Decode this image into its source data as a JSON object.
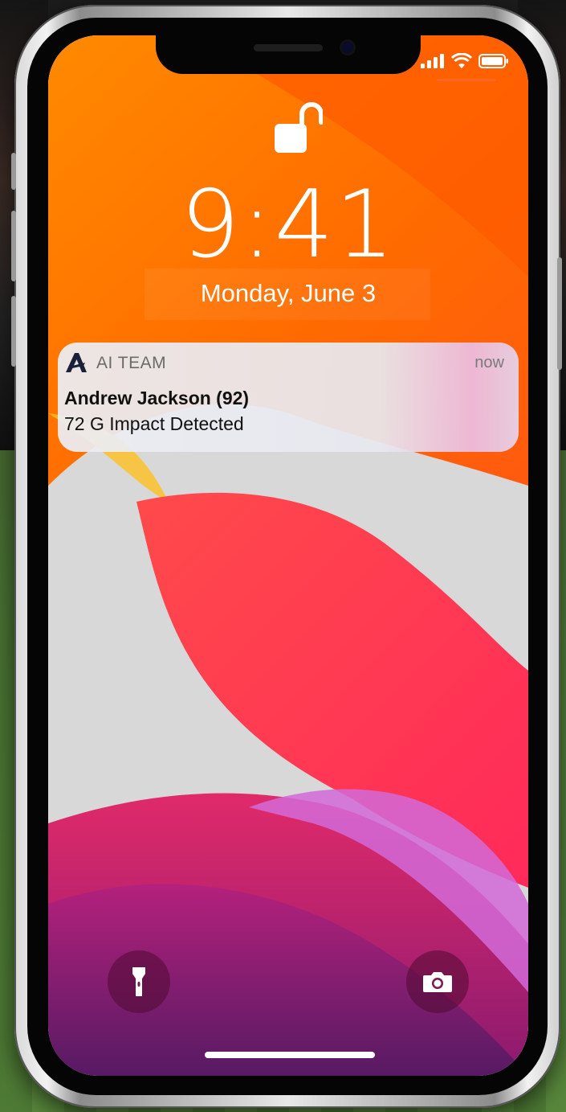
{
  "lockscreen": {
    "time": "9:41",
    "date": "Monday, June 3"
  },
  "notification": {
    "app_name": "AI TEAM",
    "timestamp": "now",
    "title": "Andrew Jackson (92)",
    "body": "72 G Impact Detected",
    "icon": "ai-team-logo-icon"
  },
  "status_bar": {
    "icons": [
      "cellular-signal-icon",
      "wifi-icon",
      "battery-icon"
    ]
  },
  "quick_actions": {
    "left_icon": "flashlight-icon",
    "right_icon": "camera-icon"
  },
  "colors": {
    "wallpaper_orange": "#ff6a00",
    "wallpaper_red": "#ff3a5a",
    "wallpaper_magenta": "#c8207a",
    "notification_bg": "#eceef4"
  }
}
